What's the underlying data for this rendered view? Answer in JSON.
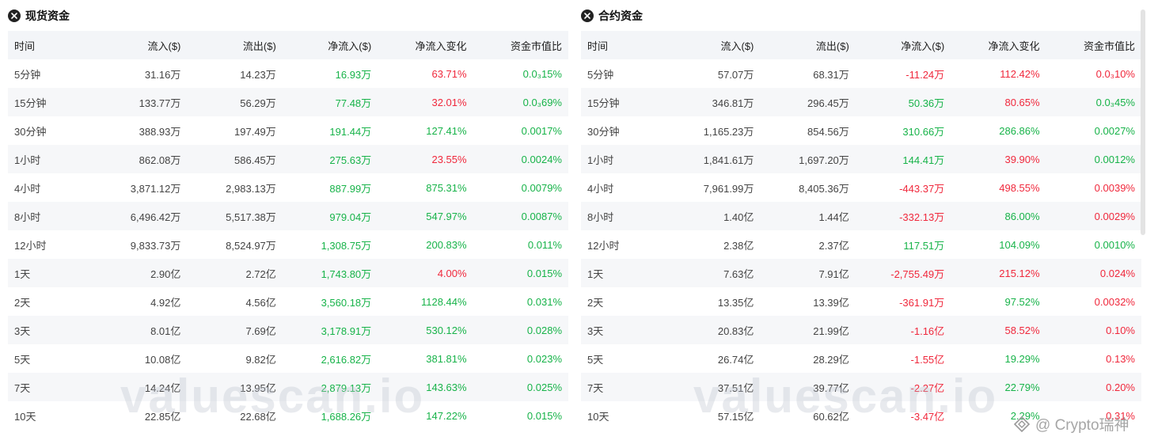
{
  "spot": {
    "title": "现货资金",
    "columns": [
      "时间",
      "流入($)",
      "流出($)",
      "净流入($)",
      "净流入变化",
      "资金市值比"
    ],
    "rows": [
      {
        "time": "5分钟",
        "inflow": "31.16万",
        "outflow": "14.23万",
        "net": "16.93万",
        "net_dir": "pos",
        "change": "63.71%",
        "change_dir": "neg",
        "ratio": "0.0₃15%",
        "ratio_dir": "pos"
      },
      {
        "time": "15分钟",
        "inflow": "133.77万",
        "outflow": "56.29万",
        "net": "77.48万",
        "net_dir": "pos",
        "change": "32.01%",
        "change_dir": "neg",
        "ratio": "0.0₃69%",
        "ratio_dir": "pos"
      },
      {
        "time": "30分钟",
        "inflow": "388.93万",
        "outflow": "197.49万",
        "net": "191.44万",
        "net_dir": "pos",
        "change": "127.41%",
        "change_dir": "pos",
        "ratio": "0.0017%",
        "ratio_dir": "pos"
      },
      {
        "time": "1小时",
        "inflow": "862.08万",
        "outflow": "586.45万",
        "net": "275.63万",
        "net_dir": "pos",
        "change": "23.55%",
        "change_dir": "neg",
        "ratio": "0.0024%",
        "ratio_dir": "pos"
      },
      {
        "time": "4小时",
        "inflow": "3,871.12万",
        "outflow": "2,983.13万",
        "net": "887.99万",
        "net_dir": "pos",
        "change": "875.31%",
        "change_dir": "pos",
        "ratio": "0.0079%",
        "ratio_dir": "pos"
      },
      {
        "time": "8小时",
        "inflow": "6,496.42万",
        "outflow": "5,517.38万",
        "net": "979.04万",
        "net_dir": "pos",
        "change": "547.97%",
        "change_dir": "pos",
        "ratio": "0.0087%",
        "ratio_dir": "pos"
      },
      {
        "time": "12小时",
        "inflow": "9,833.73万",
        "outflow": "8,524.97万",
        "net": "1,308.75万",
        "net_dir": "pos",
        "change": "200.83%",
        "change_dir": "pos",
        "ratio": "0.011%",
        "ratio_dir": "pos"
      },
      {
        "time": "1天",
        "inflow": "2.90亿",
        "outflow": "2.72亿",
        "net": "1,743.80万",
        "net_dir": "pos",
        "change": "4.00%",
        "change_dir": "neg",
        "ratio": "0.015%",
        "ratio_dir": "pos"
      },
      {
        "time": "2天",
        "inflow": "4.92亿",
        "outflow": "4.56亿",
        "net": "3,560.18万",
        "net_dir": "pos",
        "change": "1128.44%",
        "change_dir": "pos",
        "ratio": "0.031%",
        "ratio_dir": "pos"
      },
      {
        "time": "3天",
        "inflow": "8.01亿",
        "outflow": "7.69亿",
        "net": "3,178.91万",
        "net_dir": "pos",
        "change": "530.12%",
        "change_dir": "pos",
        "ratio": "0.028%",
        "ratio_dir": "pos"
      },
      {
        "time": "5天",
        "inflow": "10.08亿",
        "outflow": "9.82亿",
        "net": "2,616.82万",
        "net_dir": "pos",
        "change": "381.81%",
        "change_dir": "pos",
        "ratio": "0.023%",
        "ratio_dir": "pos"
      },
      {
        "time": "7天",
        "inflow": "14.24亿",
        "outflow": "13.95亿",
        "net": "2,879.13万",
        "net_dir": "pos",
        "change": "143.63%",
        "change_dir": "pos",
        "ratio": "0.025%",
        "ratio_dir": "pos"
      },
      {
        "time": "10天",
        "inflow": "22.85亿",
        "outflow": "22.68亿",
        "net": "1,688.26万",
        "net_dir": "pos",
        "change": "147.22%",
        "change_dir": "pos",
        "ratio": "0.015%",
        "ratio_dir": "pos"
      }
    ]
  },
  "contract": {
    "title": "合约资金",
    "columns": [
      "时间",
      "流入($)",
      "流出($)",
      "净流入($)",
      "净流入变化",
      "资金市值比"
    ],
    "rows": [
      {
        "time": "5分钟",
        "inflow": "57.07万",
        "outflow": "68.31万",
        "net": "-11.24万",
        "net_dir": "neg",
        "change": "112.42%",
        "change_dir": "neg",
        "ratio": "0.0₃10%",
        "ratio_dir": "neg"
      },
      {
        "time": "15分钟",
        "inflow": "346.81万",
        "outflow": "296.45万",
        "net": "50.36万",
        "net_dir": "pos",
        "change": "80.65%",
        "change_dir": "neg",
        "ratio": "0.0₃45%",
        "ratio_dir": "pos"
      },
      {
        "time": "30分钟",
        "inflow": "1,165.23万",
        "outflow": "854.56万",
        "net": "310.66万",
        "net_dir": "pos",
        "change": "286.86%",
        "change_dir": "pos",
        "ratio": "0.0027%",
        "ratio_dir": "pos"
      },
      {
        "time": "1小时",
        "inflow": "1,841.61万",
        "outflow": "1,697.20万",
        "net": "144.41万",
        "net_dir": "pos",
        "change": "39.90%",
        "change_dir": "neg",
        "ratio": "0.0012%",
        "ratio_dir": "pos"
      },
      {
        "time": "4小时",
        "inflow": "7,961.99万",
        "outflow": "8,405.36万",
        "net": "-443.37万",
        "net_dir": "neg",
        "change": "498.55%",
        "change_dir": "neg",
        "ratio": "0.0039%",
        "ratio_dir": "neg"
      },
      {
        "time": "8小时",
        "inflow": "1.40亿",
        "outflow": "1.44亿",
        "net": "-332.13万",
        "net_dir": "neg",
        "change": "86.00%",
        "change_dir": "pos",
        "ratio": "0.0029%",
        "ratio_dir": "neg"
      },
      {
        "time": "12小时",
        "inflow": "2.38亿",
        "outflow": "2.37亿",
        "net": "117.51万",
        "net_dir": "pos",
        "change": "104.09%",
        "change_dir": "pos",
        "ratio": "0.0010%",
        "ratio_dir": "pos"
      },
      {
        "time": "1天",
        "inflow": "7.63亿",
        "outflow": "7.91亿",
        "net": "-2,755.49万",
        "net_dir": "neg",
        "change": "215.12%",
        "change_dir": "neg",
        "ratio": "0.024%",
        "ratio_dir": "neg"
      },
      {
        "time": "2天",
        "inflow": "13.35亿",
        "outflow": "13.39亿",
        "net": "-361.91万",
        "net_dir": "neg",
        "change": "97.52%",
        "change_dir": "pos",
        "ratio": "0.0032%",
        "ratio_dir": "neg"
      },
      {
        "time": "3天",
        "inflow": "20.83亿",
        "outflow": "21.99亿",
        "net": "-1.16亿",
        "net_dir": "neg",
        "change": "58.52%",
        "change_dir": "neg",
        "ratio": "0.10%",
        "ratio_dir": "neg"
      },
      {
        "time": "5天",
        "inflow": "26.74亿",
        "outflow": "28.29亿",
        "net": "-1.55亿",
        "net_dir": "neg",
        "change": "19.29%",
        "change_dir": "pos",
        "ratio": "0.13%",
        "ratio_dir": "neg"
      },
      {
        "time": "7天",
        "inflow": "37.51亿",
        "outflow": "39.77亿",
        "net": "-2.27亿",
        "net_dir": "neg",
        "change": "22.79%",
        "change_dir": "pos",
        "ratio": "0.20%",
        "ratio_dir": "neg"
      },
      {
        "time": "10天",
        "inflow": "57.15亿",
        "outflow": "60.62亿",
        "net": "-3.47亿",
        "net_dir": "neg",
        "change": "2.29%",
        "change_dir": "pos",
        "ratio": "0.31%",
        "ratio_dir": "neg"
      }
    ]
  },
  "watermark": {
    "text": "valuescan.io"
  },
  "credit": {
    "text": "@ Crypto瑞神"
  },
  "icons": {
    "panel_icon": "close-circle-icon"
  },
  "colors": {
    "positive": "#17b349",
    "negative": "#f0283c",
    "header_bg": "#f3f5f8",
    "stripe_bg": "#f6f7f9"
  }
}
